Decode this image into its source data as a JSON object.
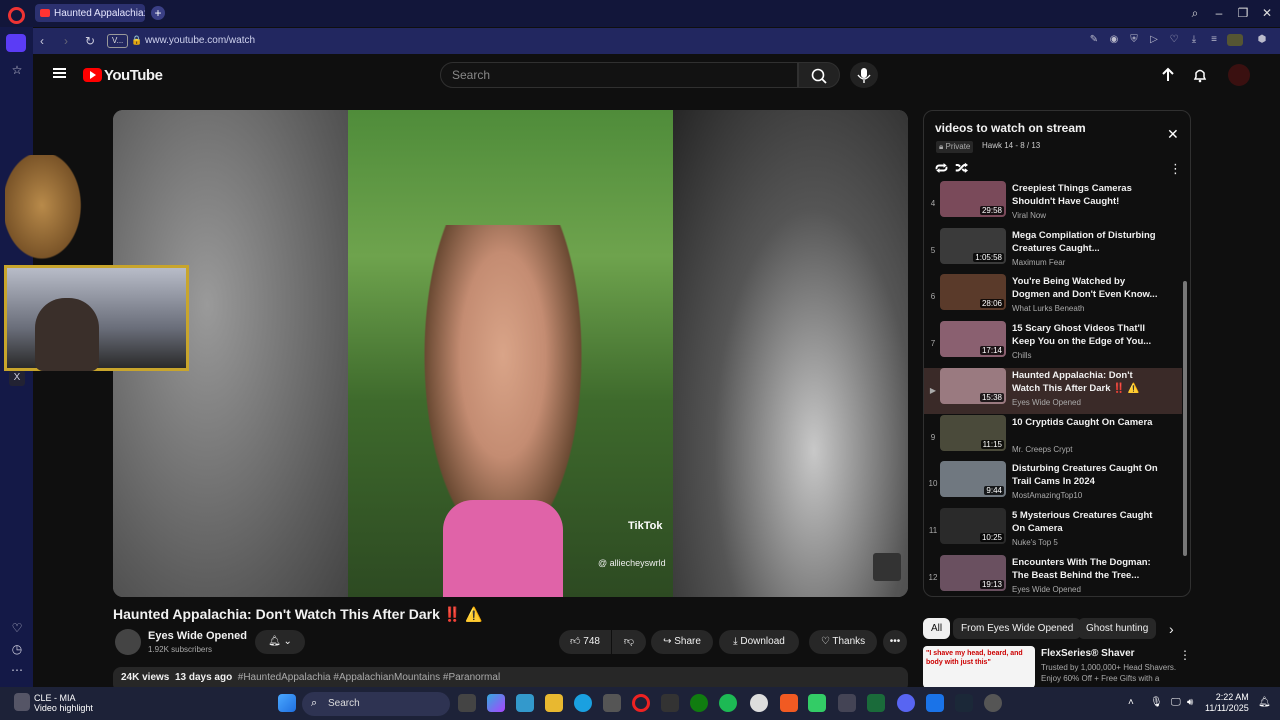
{
  "browser": {
    "tab_title": "Haunted Appalachia: D",
    "url": "www.youtube.com/watch",
    "addr_badge": "V..."
  },
  "youtube": {
    "logo_text": "YouTube",
    "search_placeholder": "Search"
  },
  "video": {
    "tiktok_label": "TikTok",
    "tiktok_user": "@ alliecheyswrld",
    "title": "Haunted Appalachia: Don't Watch This After Dark ‼️ ⚠️",
    "channel": "Eyes Wide Opened",
    "subscribers": "1.92K subscribers",
    "likes": "748",
    "share_label": "Share",
    "download_label": "Download",
    "thanks_label": "Thanks",
    "more_label": "•••",
    "views": "24K views",
    "age": "13 days ago",
    "tags": "#HauntedAppalachia #AppalachianMountains #Paranormal"
  },
  "playlist": {
    "title": "videos to watch on stream",
    "privacy": "Private",
    "meta": "Hawk 14 - 8 / 13",
    "items": [
      {
        "num": "4",
        "title": "Creepiest Things Cameras Shouldn't Have Caught!",
        "channel": "Viral Now",
        "duration": "29:58",
        "color": "#7a4a5a"
      },
      {
        "num": "5",
        "title": "Mega Compilation of Disturbing Creatures Caught...",
        "channel": "Maximum Fear",
        "duration": "1:05:58",
        "color": "#3a3a3a"
      },
      {
        "num": "6",
        "title": "You're Being Watched by Dogmen and Don't Even Know...",
        "channel": "What Lurks Beneath",
        "duration": "28:06",
        "color": "#5a3a2a"
      },
      {
        "num": "7",
        "title": "15 Scary Ghost Videos That'll Keep You on the Edge of You...",
        "channel": "Chills",
        "duration": "17:14",
        "color": "#8a6070"
      },
      {
        "num": "▶",
        "title": "Haunted Appalachia: Don't Watch This After Dark ‼️ ⚠️",
        "channel": "Eyes Wide Opened",
        "duration": "15:38",
        "color": "#9a7a80",
        "active": true
      },
      {
        "num": "9",
        "title": "10 Cryptids Caught On Camera",
        "channel": "Mr. Creeps Crypt",
        "duration": "11:15",
        "color": "#4a4a3a"
      },
      {
        "num": "10",
        "title": "Disturbing Creatures Caught On Trail Cams In 2024",
        "channel": "MostAmazingTop10",
        "duration": "9:44",
        "color": "#707880"
      },
      {
        "num": "11",
        "title": "5 Mysterious Creatures Caught On Camera",
        "channel": "Nuke's Top 5",
        "duration": "10:25",
        "color": "#2a2a2a"
      },
      {
        "num": "12",
        "title": "Encounters With The Dogman: The Beast Behind the Tree...",
        "channel": "Eyes Wide Opened",
        "duration": "19:13",
        "color": "#6a5060"
      }
    ]
  },
  "chips": [
    "All",
    "From Eyes Wide Opened",
    "Ghost hunting"
  ],
  "ad": {
    "thumb_text": "\"I shave my head, beard, and body with just this\"",
    "title": "FlexSeries® Shaver",
    "desc": "Trusted by 1,000,000+ Head Shavers. Enjoy 60% Off + Free Gifts with a"
  },
  "taskbar": {
    "weather_line1": "CLE - MIA",
    "weather_line2": "Video highlight",
    "search_label": "Search",
    "time": "2:22 AM",
    "date": "11/11/2025"
  }
}
